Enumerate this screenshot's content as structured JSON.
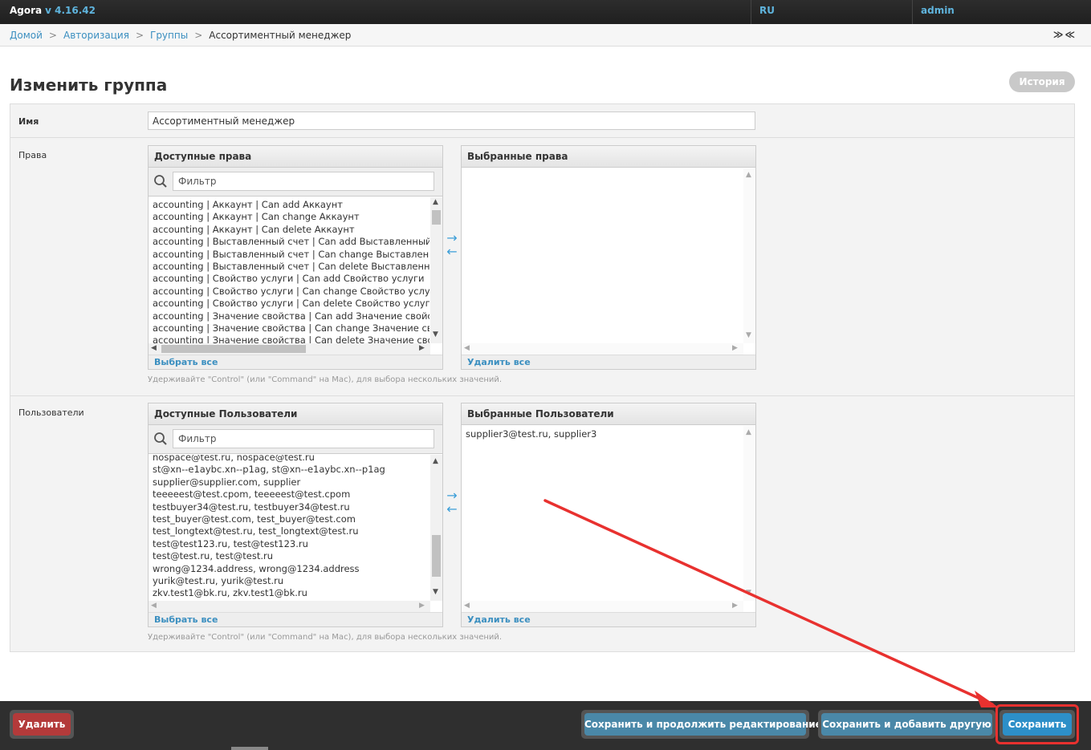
{
  "header": {
    "brand": "Agora",
    "version": "v 4.16.42",
    "language": "RU",
    "user": "admin"
  },
  "breadcrumbs": {
    "home": "Домой",
    "auth": "Авторизация",
    "groups": "Группы",
    "current": "Ассортиментный менеджер",
    "separator": ">",
    "collapse_icons": "≫≪"
  },
  "page": {
    "title": "Изменить группа",
    "history_button": "История"
  },
  "form": {
    "name": {
      "label": "Имя",
      "value": "Ассортиментный менеджер"
    },
    "permissions": {
      "label": "Права",
      "available_title": "Доступные права",
      "chosen_title": "Выбранные права",
      "filter_placeholder": "Фильтр",
      "select_all": "Выбрать все",
      "remove_all": "Удалить все",
      "hint": "Удерживайте \"Control\" (или \"Command\" на Mac), для выбора нескольких значений.",
      "available_items": [
        "accounting | Аккаунт | Can add Аккаунт",
        "accounting | Аккаунт | Can change Аккаунт",
        "accounting | Аккаунт | Can delete Аккаунт",
        "accounting | Выставленный счет | Can add Выставленный счет",
        "accounting | Выставленный счет | Can change Выставленный счет",
        "accounting | Выставленный счет | Can delete Выставленный счет",
        "accounting | Свойство услуги | Can add Свойство услуги",
        "accounting | Свойство услуги | Can change Свойство услуги",
        "accounting | Свойство услуги | Can delete Свойство услуги",
        "accounting | Значение свойства | Can add Значение свойства",
        "accounting | Значение свойства | Can change Значение свойства",
        "accounting | Значение свойства | Can delete Значение свойства"
      ],
      "chosen_items": []
    },
    "users": {
      "label": "Пользователи",
      "available_title": "Доступные Пользователи",
      "chosen_title": "Выбранные Пользователи",
      "filter_placeholder": "Фильтр",
      "select_all": "Выбрать все",
      "remove_all": "Удалить все",
      "hint": "Удерживайте \"Control\" (или \"Command\" на Mac), для выбора нескольких значений.",
      "available_items": [
        "nospace@test.ru, nospace@test.ru",
        "st@xn--e1aybc.xn--p1ag, st@xn--e1aybc.xn--p1ag",
        "supplier@supplier.com, supplier",
        "teeeeest@test.cpom, teeeeest@test.cpom",
        "testbuyer34@test.ru, testbuyer34@test.ru",
        "test_buyer@test.com, test_buyer@test.com",
        "test_longtext@test.ru, test_longtext@test.ru",
        "test@test123.ru, test@test123.ru",
        "test@test.ru, test@test.ru",
        "wrong@1234.address, wrong@1234.address",
        "yurik@test.ru, yurik@test.ru",
        "zkv.test1@bk.ru, zkv.test1@bk.ru"
      ],
      "chosen_items": [
        "supplier3@test.ru, supplier3"
      ]
    }
  },
  "actions": {
    "delete": "Удалить",
    "save_continue": "Сохранить и продолжить редактирование",
    "save_add": "Сохранить и добавить другую",
    "save": "Сохранить"
  },
  "colors": {
    "accent": "#3b8fc0",
    "danger": "#b33a3a",
    "annotation": "#e8312f"
  }
}
